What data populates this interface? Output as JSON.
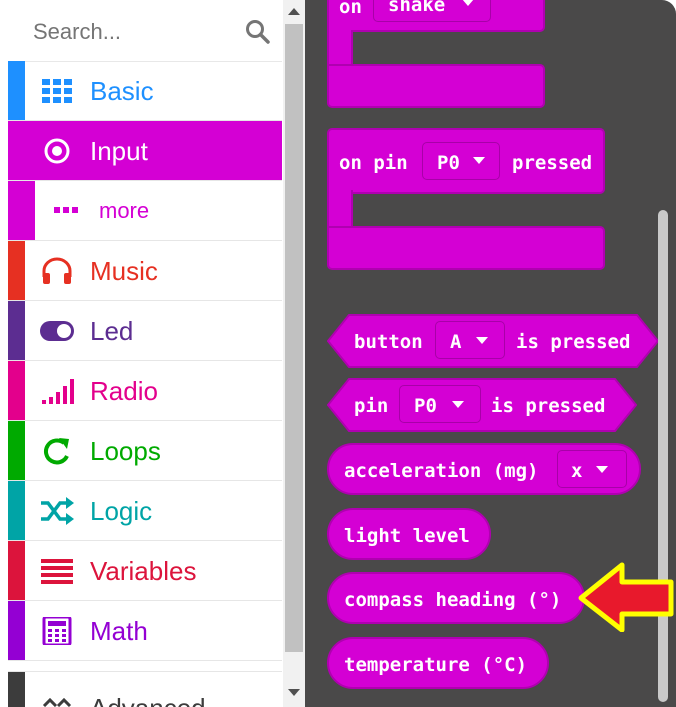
{
  "search": {
    "placeholder": "Search..."
  },
  "categories": [
    {
      "label": "Basic",
      "color": "#1e90ff",
      "icon": "grid-icon"
    },
    {
      "label": "Input",
      "color": "#d400d4",
      "icon": "target-icon",
      "selected": true
    },
    {
      "label": "more",
      "color": "#d400d4",
      "icon": "more-dots-icon"
    },
    {
      "label": "Music",
      "color": "#e63022",
      "icon": "headphones-icon"
    },
    {
      "label": "Led",
      "color": "#5c2d91",
      "icon": "toggle-icon"
    },
    {
      "label": "Radio",
      "color": "#e3008c",
      "icon": "signal-icon"
    },
    {
      "label": "Loops",
      "color": "#00aa00",
      "icon": "refresh-icon"
    },
    {
      "label": "Logic",
      "color": "#00a4a6",
      "icon": "shuffle-icon"
    },
    {
      "label": "Variables",
      "color": "#dc143c",
      "icon": "list-icon"
    },
    {
      "label": "Math",
      "color": "#9400d3",
      "icon": "calculator-icon"
    },
    {
      "label": "Advanced",
      "color": "#3c3c3c",
      "icon": "chevron-icon"
    }
  ],
  "blocks": {
    "on_shake": {
      "on": "on",
      "value": "shake"
    },
    "on_pin": {
      "prefix": "on pin",
      "value": "P0",
      "suffix": "pressed"
    },
    "button_pressed": {
      "prefix": "button",
      "value": "A",
      "suffix": "is pressed"
    },
    "pin_pressed": {
      "prefix": "pin",
      "value": "P0",
      "suffix": "is pressed"
    },
    "acceleration": {
      "prefix": "acceleration (mg)",
      "value": "x"
    },
    "light_level": {
      "label": "light level"
    },
    "compass_heading": {
      "label": "compass heading (°)"
    },
    "temperature": {
      "label": "temperature (°C)"
    }
  },
  "colors": {
    "input": "#d400d4",
    "flyout_bg": "#4a4949",
    "arrow_fill": "#e8192c",
    "arrow_outline": "#ffff00"
  }
}
